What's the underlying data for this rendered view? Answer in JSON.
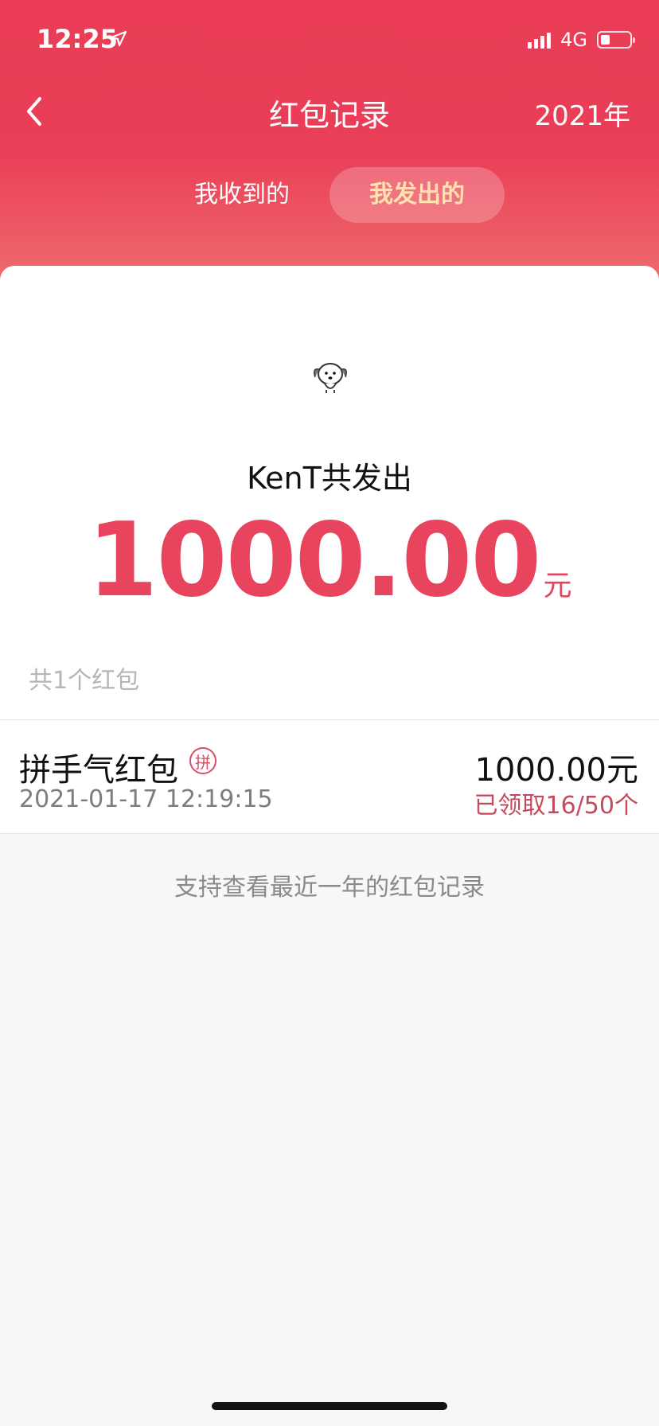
{
  "status_bar": {
    "time": "12:25",
    "network": "4G"
  },
  "nav": {
    "title": "红包记录",
    "year": "2021年"
  },
  "tabs": [
    {
      "label": "我收到的",
      "active": false
    },
    {
      "label": "我发出的",
      "active": true
    }
  ],
  "summary": {
    "sender_line": "KenT共发出",
    "amount": "1000.00",
    "unit": "元",
    "count_text": "共1个红包"
  },
  "records": [
    {
      "type": "拼手气红包",
      "badge": "拼",
      "time": "2021-01-17 12:19:15",
      "amount": "1000.00元",
      "status": "已领取16/50个"
    }
  ],
  "footer_note": "支持查看最近一年的红包记录",
  "colors": {
    "brand_red": "#ea3c56",
    "amount_red": "#e8445d",
    "tab_active_text": "#ffe2ae"
  }
}
